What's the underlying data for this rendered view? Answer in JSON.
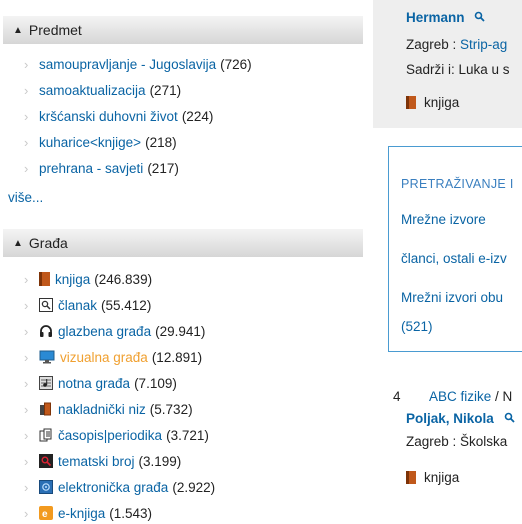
{
  "facets": {
    "predmet": {
      "title": "Predmet",
      "items": [
        {
          "label": "samoupravljanje - Jugoslavija",
          "count": "(726)"
        },
        {
          "label": "samoaktualizacija",
          "count": "(271)"
        },
        {
          "label": "kršćanski duhovni život",
          "count": "(224)"
        },
        {
          "label": "kuharice<knjige>",
          "count": "(218)"
        },
        {
          "label": "prehrana - savjeti",
          "count": "(217)"
        }
      ],
      "more_label": "više..."
    },
    "grada": {
      "title": "Građa",
      "items": [
        {
          "label": "knjiga",
          "count": "(246.839)",
          "icon": "book-icon"
        },
        {
          "label": "članak",
          "count": "(55.412)",
          "icon": "article-icon"
        },
        {
          "label": "glazbena građa",
          "count": "(29.941)",
          "icon": "headphones-icon"
        },
        {
          "label": "vizualna građa",
          "count": "(12.891)",
          "icon": "monitor-icon",
          "active": true
        },
        {
          "label": "notna građa",
          "count": "(7.109)",
          "icon": "sheet-music-icon"
        },
        {
          "label": "nakladnički niz",
          "count": "(5.732)",
          "icon": "series-icon"
        },
        {
          "label": "časopis|periodika",
          "count": "(3.721)",
          "icon": "periodical-icon"
        },
        {
          "label": "tematski broj",
          "count": "(3.199)",
          "icon": "thematic-issue-icon"
        },
        {
          "label": "elektronička građa",
          "count": "(2.922)",
          "icon": "electronic-icon"
        },
        {
          "label": "e-knjiga",
          "count": "(1.543)",
          "icon": "ebook-icon"
        }
      ]
    }
  },
  "results": {
    "first": {
      "author": "Hermann",
      "publisher_prefix": "Zagreb : ",
      "publisher_link": "Strip-ag",
      "contents": "Sadrži i: Luka u s",
      "type": "knjiga"
    },
    "search_box": {
      "heading": "PRETRAŽIVANJE I",
      "links": [
        "Mrežne izvore",
        "članci, ostali e-izv",
        "Mrežni izvori obu"
      ],
      "count": "(521)"
    },
    "second": {
      "number": "4",
      "title": "ABC fizike",
      "title_suffix": " / N",
      "author": "Poljak, Nikola",
      "publisher": "Zagreb : Školska",
      "type": "knjiga"
    }
  },
  "colors": {
    "link": "#0a64a4",
    "active": "#f0a030",
    "box_border": "#4a9bd1"
  }
}
